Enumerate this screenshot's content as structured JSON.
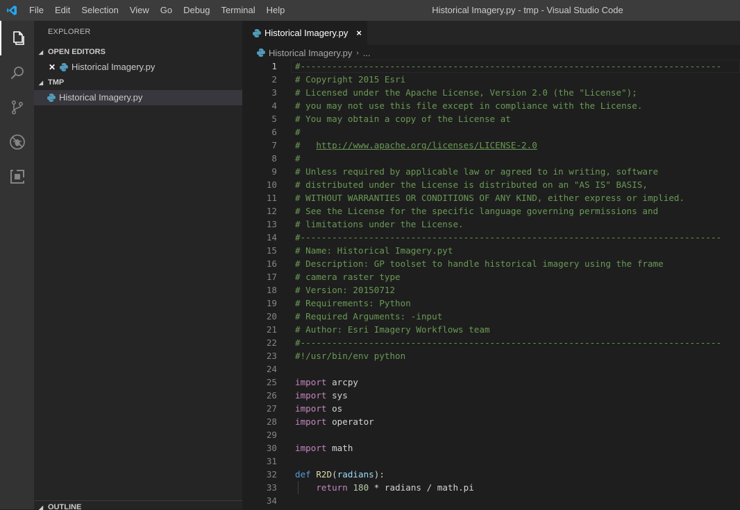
{
  "menu": {
    "items": [
      "File",
      "Edit",
      "Selection",
      "View",
      "Go",
      "Debug",
      "Terminal",
      "Help"
    ],
    "window_title": "Historical Imagery.py - tmp - Visual Studio Code"
  },
  "activity_bar": {
    "icons": [
      "files-icon",
      "search-icon",
      "source-control-icon",
      "debug-icon",
      "extensions-icon"
    ],
    "active": "files-icon"
  },
  "sidebar": {
    "title": "EXPLORER",
    "open_editors_header": "OPEN EDITORS",
    "open_editor_file": "Historical Imagery.py",
    "folder_header": "TMP",
    "folder_file": "Historical Imagery.py",
    "outline_header": "OUTLINE"
  },
  "tab": {
    "label": "Historical Imagery.py",
    "close": "×"
  },
  "breadcrumb": {
    "file": "Historical Imagery.py",
    "sep": "›",
    "more": "..."
  },
  "colors": {
    "comment": "#6a9955",
    "keyword": "#c586c0",
    "def": "#569cd6",
    "function": "#dcdcaa",
    "param": "#9cdcfe",
    "number": "#b5cea8",
    "text": "#d4d4d4",
    "accent": "#007acc"
  },
  "editor": {
    "current_line": 1,
    "lines": [
      {
        "n": "1",
        "tokens": [
          [
            "comment",
            "#--------------------------------------------------------------------------------"
          ]
        ]
      },
      {
        "n": "2",
        "tokens": [
          [
            "comment",
            "# Copyright 2015 Esri"
          ]
        ]
      },
      {
        "n": "3",
        "tokens": [
          [
            "comment",
            "# Licensed under the Apache License, Version 2.0 (the \"License\");"
          ]
        ]
      },
      {
        "n": "4",
        "tokens": [
          [
            "comment",
            "# you may not use this file except in compliance with the License."
          ]
        ]
      },
      {
        "n": "5",
        "tokens": [
          [
            "comment",
            "# You may obtain a copy of the License at"
          ]
        ]
      },
      {
        "n": "6",
        "tokens": [
          [
            "comment",
            "#"
          ]
        ]
      },
      {
        "n": "7",
        "tokens": [
          [
            "comment",
            "#   "
          ],
          [
            "link",
            "http://www.apache.org/licenses/LICENSE-2.0"
          ]
        ]
      },
      {
        "n": "8",
        "tokens": [
          [
            "comment",
            "#"
          ]
        ]
      },
      {
        "n": "9",
        "tokens": [
          [
            "comment",
            "# Unless required by applicable law or agreed to in writing, software"
          ]
        ]
      },
      {
        "n": "10",
        "tokens": [
          [
            "comment",
            "# distributed under the License is distributed on an \"AS IS\" BASIS,"
          ]
        ]
      },
      {
        "n": "11",
        "tokens": [
          [
            "comment",
            "# WITHOUT WARRANTIES OR CONDITIONS OF ANY KIND, either express or implied."
          ]
        ]
      },
      {
        "n": "12",
        "tokens": [
          [
            "comment",
            "# See the License for the specific language governing permissions and"
          ]
        ]
      },
      {
        "n": "13",
        "tokens": [
          [
            "comment",
            "# limitations under the License."
          ]
        ]
      },
      {
        "n": "14",
        "tokens": [
          [
            "comment",
            "#--------------------------------------------------------------------------------"
          ]
        ]
      },
      {
        "n": "15",
        "tokens": [
          [
            "comment",
            "# Name: Historical Imagery.pyt"
          ]
        ]
      },
      {
        "n": "16",
        "tokens": [
          [
            "comment",
            "# Description: GP toolset to handle historical imagery using the frame"
          ]
        ]
      },
      {
        "n": "17",
        "tokens": [
          [
            "comment",
            "# camera raster type"
          ]
        ]
      },
      {
        "n": "18",
        "tokens": [
          [
            "comment",
            "# Version: 20150712"
          ]
        ]
      },
      {
        "n": "19",
        "tokens": [
          [
            "comment",
            "# Requirements: Python"
          ]
        ]
      },
      {
        "n": "20",
        "tokens": [
          [
            "comment",
            "# Required Arguments: -input"
          ]
        ]
      },
      {
        "n": "21",
        "tokens": [
          [
            "comment",
            "# Author: Esri Imagery Workflows team"
          ]
        ]
      },
      {
        "n": "22",
        "tokens": [
          [
            "comment",
            "#--------------------------------------------------------------------------------"
          ]
        ]
      },
      {
        "n": "23",
        "tokens": [
          [
            "comment",
            "#!/usr/bin/env python"
          ]
        ]
      },
      {
        "n": "24",
        "tokens": []
      },
      {
        "n": "25",
        "tokens": [
          [
            "keyword",
            "import"
          ],
          [
            "plain",
            " arcpy"
          ]
        ]
      },
      {
        "n": "26",
        "tokens": [
          [
            "keyword",
            "import"
          ],
          [
            "plain",
            " sys"
          ]
        ]
      },
      {
        "n": "27",
        "tokens": [
          [
            "keyword",
            "import"
          ],
          [
            "plain",
            " os"
          ]
        ]
      },
      {
        "n": "28",
        "tokens": [
          [
            "keyword",
            "import"
          ],
          [
            "plain",
            " operator"
          ]
        ]
      },
      {
        "n": "29",
        "tokens": []
      },
      {
        "n": "30",
        "tokens": [
          [
            "keyword",
            "import"
          ],
          [
            "plain",
            " math"
          ]
        ]
      },
      {
        "n": "31",
        "tokens": []
      },
      {
        "n": "32",
        "tokens": [
          [
            "def",
            "def"
          ],
          [
            "plain",
            " "
          ],
          [
            "fn",
            "R2D"
          ],
          [
            "plain",
            "("
          ],
          [
            "param",
            "radians"
          ],
          [
            "plain",
            "):"
          ]
        ]
      },
      {
        "n": "33",
        "tokens": [
          [
            "plain",
            "    "
          ],
          [
            "keyword",
            "return"
          ],
          [
            "plain",
            " "
          ],
          [
            "num",
            "180"
          ],
          [
            "plain",
            " * radians / math.pi"
          ]
        ],
        "indent": true
      },
      {
        "n": "34",
        "tokens": []
      }
    ]
  }
}
